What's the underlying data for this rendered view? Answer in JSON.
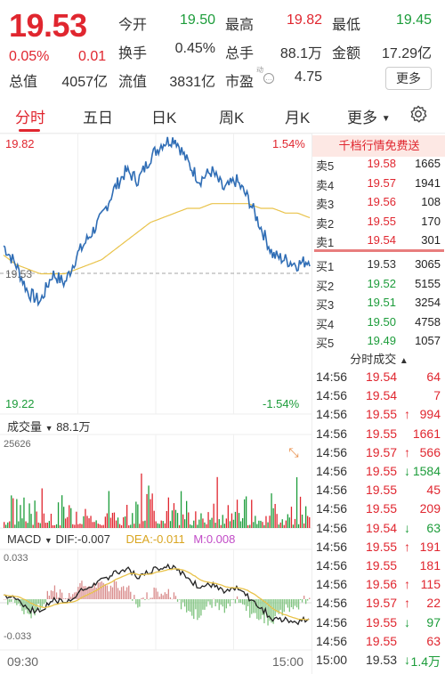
{
  "quote": {
    "price": "19.53",
    "change_pct": "0.05%",
    "change": "0.01",
    "stats": [
      {
        "label": "今开",
        "value": "19.50",
        "color": "green"
      },
      {
        "label": "最高",
        "value": "19.82",
        "color": "red"
      },
      {
        "label": "最低",
        "value": "19.45",
        "color": "green"
      },
      {
        "label": "换手",
        "value": "0.45%",
        "color": "dark"
      },
      {
        "label": "总手",
        "value": "88.1万",
        "color": "dark"
      },
      {
        "label": "金额",
        "value": "17.29亿",
        "color": "dark"
      },
      {
        "label": "总值",
        "value": "4057亿",
        "color": "dark"
      },
      {
        "label": "流值",
        "value": "3831亿",
        "color": "dark"
      },
      {
        "label": "市盈",
        "value": "4.75",
        "color": "dark"
      }
    ],
    "pe_tag": "动",
    "more_label": "更多"
  },
  "tabs": {
    "items": [
      "分时",
      "五日",
      "日K",
      "周K",
      "月K",
      "更多"
    ],
    "active": "分时",
    "more_icon": "caret-down-icon",
    "settings_icon": "gear-icon"
  },
  "chart": {
    "price_high": "19.82",
    "pct_high": "1.54%",
    "price_low": "19.22",
    "pct_low": "-1.54%",
    "prev_close_label": "19.53",
    "volume_label": "成交量",
    "volume_total": "88.1万",
    "volume_max": "25626",
    "macd_label": "MACD",
    "dif": "DIF:-0.007",
    "dea": "DEA:-0.011",
    "m": "M:0.008",
    "macd_top": "0.033",
    "macd_bottom": "-0.033",
    "time_start": "09:30",
    "time_end": "15:00",
    "expand_icon": "expand-icon",
    "colors": {
      "up": "#e0262f",
      "down": "#1c9c3a",
      "price_line": "#2f6db5",
      "avg_line": "#e9c34a",
      "dif_line": "#222222",
      "dea_line": "#e9c34a"
    }
  },
  "chart_data": {
    "type": "line",
    "title": "",
    "xlabel": "",
    "ylabel": "",
    "x_range": [
      "09:30",
      "15:00"
    ],
    "ylim": [
      19.22,
      19.82
    ],
    "prev_close": 19.53,
    "series": [
      {
        "values": [
          19.58,
          19.54,
          19.48,
          19.46,
          19.52,
          19.5,
          19.56,
          19.6,
          19.64,
          19.7,
          19.74,
          19.72,
          19.77,
          19.8,
          19.81,
          19.76,
          19.72,
          19.74,
          19.7,
          19.72,
          19.68,
          19.62,
          19.56,
          19.55,
          19.54,
          19.55
        ]
      },
      {
        "values": [
          19.56,
          19.54,
          19.53,
          19.52,
          19.52,
          19.52,
          19.53,
          19.54,
          19.55,
          19.57,
          19.59,
          19.61,
          19.63,
          19.64,
          19.65,
          19.66,
          19.66,
          19.67,
          19.67,
          19.67,
          19.67,
          19.66,
          19.66,
          19.65,
          19.65,
          19.64
        ]
      }
    ]
  },
  "book": {
    "promo": "千档行情免费送",
    "asks": [
      {
        "label": "卖5",
        "price": "19.58",
        "vol": "1665"
      },
      {
        "label": "卖4",
        "price": "19.57",
        "vol": "1941"
      },
      {
        "label": "卖3",
        "price": "19.56",
        "vol": "108"
      },
      {
        "label": "卖2",
        "price": "19.55",
        "vol": "170"
      },
      {
        "label": "卖1",
        "price": "19.54",
        "vol": "301"
      }
    ],
    "bids": [
      {
        "label": "买1",
        "price": "19.53",
        "vol": "3065"
      },
      {
        "label": "买2",
        "price": "19.52",
        "vol": "5155"
      },
      {
        "label": "买3",
        "price": "19.51",
        "vol": "3254"
      },
      {
        "label": "买4",
        "price": "19.50",
        "vol": "4758"
      },
      {
        "label": "买5",
        "price": "19.49",
        "vol": "1057"
      }
    ]
  },
  "trades": {
    "title": "分时成交",
    "title_icon": "caret-up-icon",
    "rows": [
      {
        "time": "14:56",
        "price": "19.54",
        "vol": "64",
        "dir": ""
      },
      {
        "time": "14:56",
        "price": "19.54",
        "vol": "7",
        "dir": ""
      },
      {
        "time": "14:56",
        "price": "19.55",
        "vol": "994",
        "dir": "↑"
      },
      {
        "time": "14:56",
        "price": "19.55",
        "vol": "1661",
        "dir": ""
      },
      {
        "time": "14:56",
        "price": "19.57",
        "vol": "566",
        "dir": "↑"
      },
      {
        "time": "14:56",
        "price": "19.55",
        "vol": "1584",
        "dir": "↓"
      },
      {
        "time": "14:56",
        "price": "19.55",
        "vol": "45",
        "dir": ""
      },
      {
        "time": "14:56",
        "price": "19.55",
        "vol": "209",
        "dir": ""
      },
      {
        "time": "14:56",
        "price": "19.54",
        "vol": "63",
        "dir": "↓"
      },
      {
        "time": "14:56",
        "price": "19.55",
        "vol": "191",
        "dir": "↑"
      },
      {
        "time": "14:56",
        "price": "19.55",
        "vol": "181",
        "dir": ""
      },
      {
        "time": "14:56",
        "price": "19.56",
        "vol": "115",
        "dir": "↑"
      },
      {
        "time": "14:56",
        "price": "19.57",
        "vol": "22",
        "dir": "↑"
      },
      {
        "time": "14:56",
        "price": "19.55",
        "vol": "97",
        "dir": "↓"
      },
      {
        "time": "14:56",
        "price": "19.55",
        "vol": "63",
        "dir": ""
      },
      {
        "time": "15:00",
        "price": "19.53",
        "vol": "1.4万",
        "dir": "↓"
      }
    ]
  }
}
